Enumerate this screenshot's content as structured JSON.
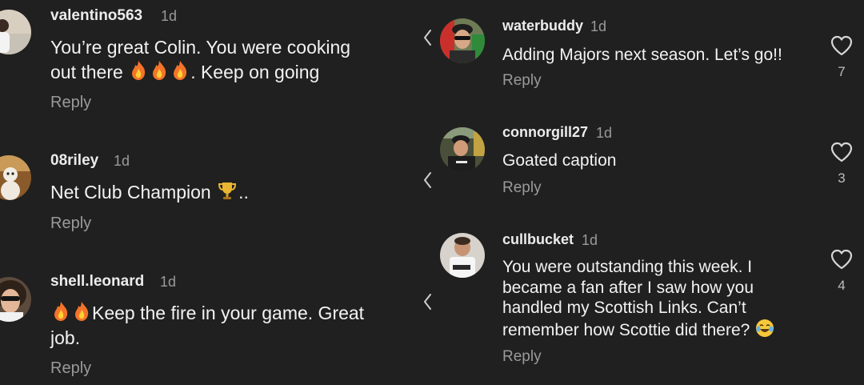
{
  "reply_label": "Reply",
  "left_comments": [
    {
      "username": "valentino563",
      "age": "1d",
      "line1": "You’re great Colin. You were cooking",
      "line2_prefix": "out there ",
      "line2_suffix": ". Keep on going"
    },
    {
      "username": "08riley",
      "age": "1d",
      "text_prefix": "Net Club Champion ",
      "text_suffix": ".."
    },
    {
      "username": "shell.leonard",
      "age": "1d",
      "line1_suffix": "Keep the fire in your game. Great",
      "line2": "job."
    }
  ],
  "right_comments": [
    {
      "username": "waterbuddy",
      "age": "1d",
      "text": "Adding Majors next season. Let’s go!!",
      "likes": "7"
    },
    {
      "username": "connorgill27",
      "age": "1d",
      "text": "Goated caption",
      "likes": "3"
    },
    {
      "username": "cullbucket",
      "age": "1d",
      "lines": [
        "You were outstanding this week. I",
        "became a fan after I saw how you",
        "handled my Scottish Links. Can’t",
        "remember how Scottie did there?"
      ],
      "likes": "4"
    }
  ],
  "icons": {
    "fire": "fire-emoji",
    "trophy": "trophy-emoji",
    "laugh": "tears-of-joy-emoji",
    "heart": "heart-outline-icon",
    "chevron": "chevron-left-icon"
  },
  "colors": {
    "background": "#202020",
    "text": "#f2f2f2",
    "muted": "#9a9a9a"
  }
}
